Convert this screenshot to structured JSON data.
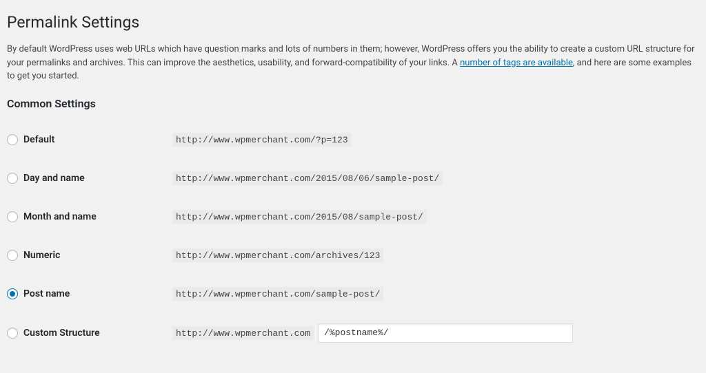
{
  "page": {
    "title": "Permalink Settings",
    "description_pre": "By default WordPress uses web URLs which have question marks and lots of numbers in them; however, WordPress offers you the ability to create a custom URL structure for your permalinks and archives. This can improve the aesthetics, usability, and forward-compatibility of your links. A ",
    "description_link": "number of tags are available",
    "description_post": ", and here are some examples to get you started."
  },
  "common_settings": {
    "heading": "Common Settings",
    "options": [
      {
        "label": "Default",
        "example": "http://www.wpmerchant.com/?p=123",
        "checked": false
      },
      {
        "label": "Day and name",
        "example": "http://www.wpmerchant.com/2015/08/06/sample-post/",
        "checked": false
      },
      {
        "label": "Month and name",
        "example": "http://www.wpmerchant.com/2015/08/sample-post/",
        "checked": false
      },
      {
        "label": "Numeric",
        "example": "http://www.wpmerchant.com/archives/123",
        "checked": false
      },
      {
        "label": "Post name",
        "example": "http://www.wpmerchant.com/sample-post/",
        "checked": true
      },
      {
        "label": "Custom Structure",
        "prefix": "http://www.wpmerchant.com",
        "value": "/%postname%/",
        "checked": false,
        "custom": true
      }
    ]
  }
}
